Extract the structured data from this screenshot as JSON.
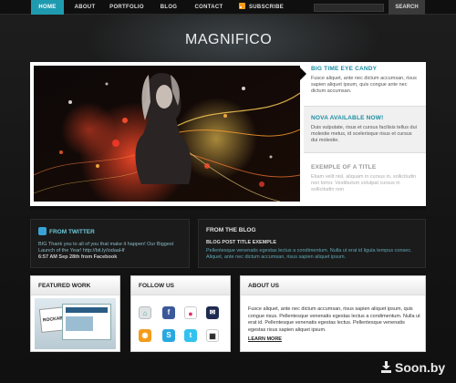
{
  "nav": {
    "items": [
      {
        "label": "HOME",
        "active": true
      },
      {
        "label": "ABOUT",
        "active": false
      },
      {
        "label": "PORTFOLIO",
        "active": false
      },
      {
        "label": "BLOG",
        "active": false
      },
      {
        "label": "CONTACT",
        "active": false
      },
      {
        "label": "SUBSCRIBE",
        "active": false
      }
    ],
    "search_button": "SEARCH",
    "search_value": ""
  },
  "logo": {
    "text": "MAGNIFICO"
  },
  "slider": {
    "items": [
      {
        "title": "BIG TIME EYE CANDY",
        "text": "Fusce aliquet, ante nec dictum accumsan, risus sapien aliquet ipsum, quis congue ante nec dictum accumsan."
      },
      {
        "title": "NOVA AVAILABLE NOW!",
        "text": "Duis vulputate, risus et cursus facilisis tellus dui molestie metus, id scelerisque risus et cursus dui molestie."
      },
      {
        "title": "EXEMPLE OF A TITLE",
        "text": "Etiam velit nisl, aliquam in cursus in, sollicitudin non tortor. Vestibulum volutpat cursus in sollicitudin non"
      }
    ]
  },
  "twitter": {
    "title": "FROM TWITTER",
    "tweet": "BIG Thank you to all of you that make it happen! Our Biggest Launch of the Year! http://bit.ly/iodaaHf",
    "meta": "6:57 AM Sep 28th from Facebook"
  },
  "blog": {
    "title": "FROM THE BLOG",
    "post_title": "BLOG POST TITLE EXEMPLE",
    "excerpt": "Pellentesque venenatis egestas lectus a condimentum. Nulla ut erat id ligula tempus consec. Aliquet, ante nec dictum accumsan, risus sapien aliquet ipsum."
  },
  "featured": {
    "title": "FEATURED WORK",
    "thumb_label": "ROCKABLE"
  },
  "follow": {
    "title": "FOLLOW US",
    "icons": [
      "delicious-icon",
      "facebook-icon",
      "flickr-icon",
      "myspace-icon",
      "rss-icon",
      "skype-icon",
      "twitter-icon",
      "digg-icon"
    ]
  },
  "about": {
    "title": "ABOUT US",
    "text": "Fusce aliquet, ante nec dictum accumsan, risus sapien aliquet ipsum, quis congue risus. Pellentesque venenatis egestas lectus a condimentum. Nulla ut erat id. Pellentesque venenatis egestas lectus. Pellentesque venenatis egestas risus sapien aliquet ipsum.",
    "link": "LEARN MORE"
  },
  "watermark": {
    "text": "Soon.by"
  }
}
